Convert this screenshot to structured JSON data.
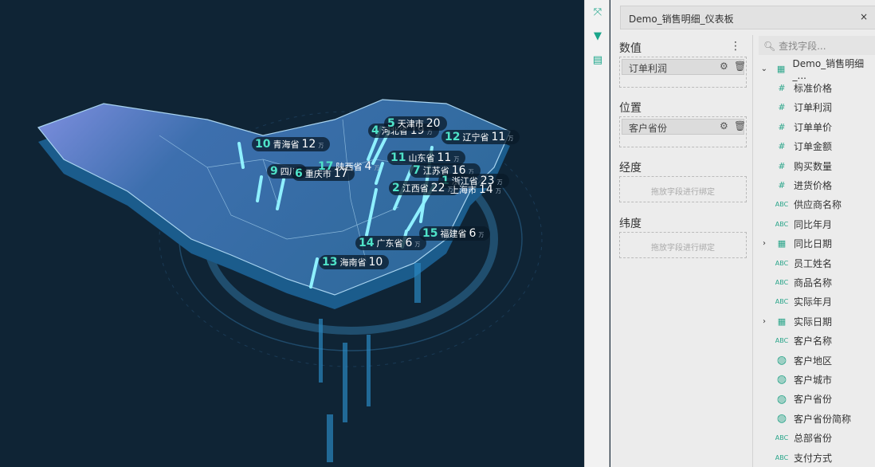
{
  "map": {
    "unit": "万",
    "labels": [
      {
        "rank": "10",
        "name": "青海省",
        "value": "12"
      },
      {
        "rank": "4",
        "name": "河北省",
        "value": "19"
      },
      {
        "rank": "5",
        "name": "天津市",
        "value": "20"
      },
      {
        "rank": "12",
        "name": "辽宁省",
        "value": "11"
      },
      {
        "rank": "9",
        "name": "四川",
        "value": ""
      },
      {
        "rank": "6",
        "name": "重庆市",
        "value": "17"
      },
      {
        "rank": "17",
        "name": "陕西省",
        "value": "4"
      },
      {
        "rank": "11",
        "name": "山东省",
        "value": "11"
      },
      {
        "rank": "7",
        "name": "江苏省",
        "value": "16"
      },
      {
        "rank": "1",
        "name": "浙江省",
        "value": "23"
      },
      {
        "rank": "2",
        "name": "江西省",
        "value": "22"
      },
      {
        "rank": "",
        "name": "上海市",
        "value": "14"
      },
      {
        "rank": "15",
        "name": "福建省",
        "value": "6"
      },
      {
        "rank": "14",
        "name": "广东省",
        "value": "6"
      },
      {
        "rank": "13",
        "name": "海南省",
        "value": "10"
      }
    ]
  },
  "tools": [
    "collapse-icon",
    "filter-icon",
    "comment-icon"
  ],
  "panel": {
    "dataset": "Demo_销售明细_仪表板",
    "close": "×",
    "value_title": "数值",
    "value_field": "订单利润",
    "position_title": "位置",
    "position_field": "客户省份",
    "lon_title": "经度",
    "lon_placeholder": "拖放字段进行绑定",
    "lat_title": "纬度",
    "lat_placeholder": "拖放字段进行绑定",
    "search_placeholder": "查找字段...",
    "root": "Demo_销售明细_...",
    "fields": [
      {
        "type": "#",
        "name": "标准价格"
      },
      {
        "type": "#",
        "name": "订单利润"
      },
      {
        "type": "#",
        "name": "订单单价"
      },
      {
        "type": "#",
        "name": "订单金额"
      },
      {
        "type": "#",
        "name": "购买数量"
      },
      {
        "type": "#",
        "name": "进货价格"
      },
      {
        "type": "ABC",
        "name": "供应商名称"
      },
      {
        "type": "ABC",
        "name": "同比年月"
      },
      {
        "type": "date",
        "name": "同比日期"
      },
      {
        "type": "ABC",
        "name": "员工姓名"
      },
      {
        "type": "ABC",
        "name": "商品名称"
      },
      {
        "type": "ABC",
        "name": "实际年月"
      },
      {
        "type": "date",
        "name": "实际日期"
      },
      {
        "type": "ABC",
        "name": "客户名称"
      },
      {
        "type": "geo",
        "name": "客户地区"
      },
      {
        "type": "geo",
        "name": "客户城市"
      },
      {
        "type": "geo",
        "name": "客户省份"
      },
      {
        "type": "geo",
        "name": "客户省份简称"
      },
      {
        "type": "ABC",
        "name": "总部省份"
      },
      {
        "type": "ABC",
        "name": "支付方式"
      }
    ]
  }
}
